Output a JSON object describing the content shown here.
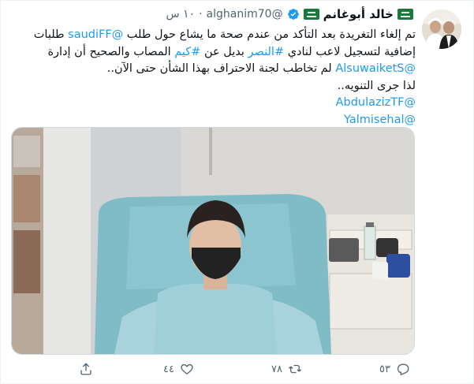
{
  "tweet": {
    "author_name": "خالد أبوغانم",
    "handle": "@alghanim70",
    "separator": "·",
    "time": "١٠ س",
    "lines": [
      {
        "parts": [
          {
            "text": "تم إلغاء التغريدة بعد التأكد من عندم صحة ما يشاع حول طلب ",
            "link": false
          },
          {
            "text": "@saudiFF",
            "link": true
          },
          {
            "text": " طلبات",
            "link": false
          }
        ]
      },
      {
        "parts": [
          {
            "text": "إضافية لتسجيل لاعب لنادي ",
            "link": false
          },
          {
            "text": "#النصر",
            "link": true
          },
          {
            "text": " بديل عن ",
            "link": false
          },
          {
            "text": "#كيم",
            "link": true
          },
          {
            "text": " المصاب والصحيح أن إدارة",
            "link": false
          }
        ]
      },
      {
        "parts": [
          {
            "text": "@AlsuwaiketS",
            "link": true
          },
          {
            "text": " لم تخاطب لجنة الاحتراف بهذا الشأن حتى الآن..",
            "link": false
          }
        ]
      },
      {
        "parts": [
          {
            "text": "لذا جرى التنويه..",
            "link": false
          }
        ]
      },
      {
        "parts": [
          {
            "text": "@AbdulazizTF",
            "link": true
          }
        ]
      },
      {
        "parts": [
          {
            "text": "@Yalmisehal",
            "link": true
          }
        ]
      }
    ]
  },
  "actions": {
    "reply_count": "٥٣",
    "retweet_count": "٧٨",
    "like_count": "٤٤"
  },
  "colors": {
    "link": "#1d9bf0",
    "muted": "#536471",
    "verified": "#1d9bf0",
    "flag": "#1a7a3c"
  },
  "icons": [
    "saudi-flag-icon",
    "verified-icon",
    "reply-icon",
    "retweet-icon",
    "like-icon",
    "share-icon"
  ]
}
